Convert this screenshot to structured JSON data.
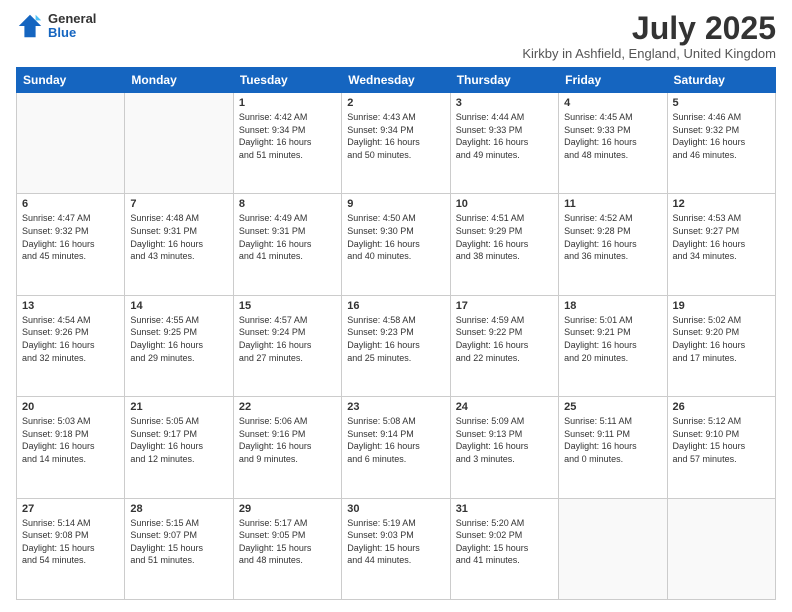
{
  "header": {
    "logo_general": "General",
    "logo_blue": "Blue",
    "title": "July 2025",
    "subtitle": "Kirkby in Ashfield, England, United Kingdom"
  },
  "days_of_week": [
    "Sunday",
    "Monday",
    "Tuesday",
    "Wednesday",
    "Thursday",
    "Friday",
    "Saturday"
  ],
  "weeks": [
    [
      {
        "day": "",
        "info": ""
      },
      {
        "day": "",
        "info": ""
      },
      {
        "day": "1",
        "info": "Sunrise: 4:42 AM\nSunset: 9:34 PM\nDaylight: 16 hours\nand 51 minutes."
      },
      {
        "day": "2",
        "info": "Sunrise: 4:43 AM\nSunset: 9:34 PM\nDaylight: 16 hours\nand 50 minutes."
      },
      {
        "day": "3",
        "info": "Sunrise: 4:44 AM\nSunset: 9:33 PM\nDaylight: 16 hours\nand 49 minutes."
      },
      {
        "day": "4",
        "info": "Sunrise: 4:45 AM\nSunset: 9:33 PM\nDaylight: 16 hours\nand 48 minutes."
      },
      {
        "day": "5",
        "info": "Sunrise: 4:46 AM\nSunset: 9:32 PM\nDaylight: 16 hours\nand 46 minutes."
      }
    ],
    [
      {
        "day": "6",
        "info": "Sunrise: 4:47 AM\nSunset: 9:32 PM\nDaylight: 16 hours\nand 45 minutes."
      },
      {
        "day": "7",
        "info": "Sunrise: 4:48 AM\nSunset: 9:31 PM\nDaylight: 16 hours\nand 43 minutes."
      },
      {
        "day": "8",
        "info": "Sunrise: 4:49 AM\nSunset: 9:31 PM\nDaylight: 16 hours\nand 41 minutes."
      },
      {
        "day": "9",
        "info": "Sunrise: 4:50 AM\nSunset: 9:30 PM\nDaylight: 16 hours\nand 40 minutes."
      },
      {
        "day": "10",
        "info": "Sunrise: 4:51 AM\nSunset: 9:29 PM\nDaylight: 16 hours\nand 38 minutes."
      },
      {
        "day": "11",
        "info": "Sunrise: 4:52 AM\nSunset: 9:28 PM\nDaylight: 16 hours\nand 36 minutes."
      },
      {
        "day": "12",
        "info": "Sunrise: 4:53 AM\nSunset: 9:27 PM\nDaylight: 16 hours\nand 34 minutes."
      }
    ],
    [
      {
        "day": "13",
        "info": "Sunrise: 4:54 AM\nSunset: 9:26 PM\nDaylight: 16 hours\nand 32 minutes."
      },
      {
        "day": "14",
        "info": "Sunrise: 4:55 AM\nSunset: 9:25 PM\nDaylight: 16 hours\nand 29 minutes."
      },
      {
        "day": "15",
        "info": "Sunrise: 4:57 AM\nSunset: 9:24 PM\nDaylight: 16 hours\nand 27 minutes."
      },
      {
        "day": "16",
        "info": "Sunrise: 4:58 AM\nSunset: 9:23 PM\nDaylight: 16 hours\nand 25 minutes."
      },
      {
        "day": "17",
        "info": "Sunrise: 4:59 AM\nSunset: 9:22 PM\nDaylight: 16 hours\nand 22 minutes."
      },
      {
        "day": "18",
        "info": "Sunrise: 5:01 AM\nSunset: 9:21 PM\nDaylight: 16 hours\nand 20 minutes."
      },
      {
        "day": "19",
        "info": "Sunrise: 5:02 AM\nSunset: 9:20 PM\nDaylight: 16 hours\nand 17 minutes."
      }
    ],
    [
      {
        "day": "20",
        "info": "Sunrise: 5:03 AM\nSunset: 9:18 PM\nDaylight: 16 hours\nand 14 minutes."
      },
      {
        "day": "21",
        "info": "Sunrise: 5:05 AM\nSunset: 9:17 PM\nDaylight: 16 hours\nand 12 minutes."
      },
      {
        "day": "22",
        "info": "Sunrise: 5:06 AM\nSunset: 9:16 PM\nDaylight: 16 hours\nand 9 minutes."
      },
      {
        "day": "23",
        "info": "Sunrise: 5:08 AM\nSunset: 9:14 PM\nDaylight: 16 hours\nand 6 minutes."
      },
      {
        "day": "24",
        "info": "Sunrise: 5:09 AM\nSunset: 9:13 PM\nDaylight: 16 hours\nand 3 minutes."
      },
      {
        "day": "25",
        "info": "Sunrise: 5:11 AM\nSunset: 9:11 PM\nDaylight: 16 hours\nand 0 minutes."
      },
      {
        "day": "26",
        "info": "Sunrise: 5:12 AM\nSunset: 9:10 PM\nDaylight: 15 hours\nand 57 minutes."
      }
    ],
    [
      {
        "day": "27",
        "info": "Sunrise: 5:14 AM\nSunset: 9:08 PM\nDaylight: 15 hours\nand 54 minutes."
      },
      {
        "day": "28",
        "info": "Sunrise: 5:15 AM\nSunset: 9:07 PM\nDaylight: 15 hours\nand 51 minutes."
      },
      {
        "day": "29",
        "info": "Sunrise: 5:17 AM\nSunset: 9:05 PM\nDaylight: 15 hours\nand 48 minutes."
      },
      {
        "day": "30",
        "info": "Sunrise: 5:19 AM\nSunset: 9:03 PM\nDaylight: 15 hours\nand 44 minutes."
      },
      {
        "day": "31",
        "info": "Sunrise: 5:20 AM\nSunset: 9:02 PM\nDaylight: 15 hours\nand 41 minutes."
      },
      {
        "day": "",
        "info": ""
      },
      {
        "day": "",
        "info": ""
      }
    ]
  ]
}
